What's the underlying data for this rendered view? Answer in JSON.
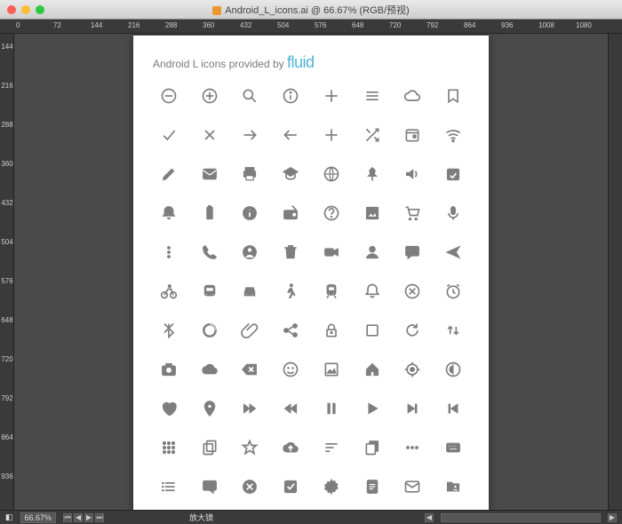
{
  "window": {
    "title": "Android_L_icons.ai @ 66.67% (RGB/预视)"
  },
  "ruler_top": [
    "0",
    "72",
    "144",
    "216",
    "288",
    "360",
    "432",
    "504",
    "576",
    "648",
    "720",
    "792",
    "864",
    "936",
    "1008",
    "1080"
  ],
  "ruler_left": [
    "144",
    "216",
    "288",
    "360",
    "432",
    "504",
    "576",
    "648",
    "720",
    "792",
    "864",
    "936"
  ],
  "artboard": {
    "headline_prefix": "Android L icons provided by ",
    "brand": "fluid"
  },
  "icons": [
    [
      "remove-circle-icon",
      "add-circle-icon",
      "search-icon",
      "info-outline-icon",
      "add-icon",
      "menu-icon",
      "cloud-outline-icon",
      "bookmark-outline-icon"
    ],
    [
      "check-icon",
      "close-icon",
      "arrow-right-icon",
      "arrow-left-icon",
      "add-icon",
      "shuffle-icon",
      "event-icon",
      "wifi-icon"
    ],
    [
      "edit-icon",
      "email-icon",
      "print-icon",
      "school-icon",
      "public-icon",
      "pin-icon",
      "volume-icon",
      "event-available-icon"
    ],
    [
      "notifications-icon",
      "battery-icon",
      "info-icon",
      "radio-icon",
      "help-icon",
      "image-icon",
      "shopping-cart-icon",
      "mic-icon"
    ],
    [
      "more-vert-icon",
      "call-icon",
      "account-circle-icon",
      "delete-icon",
      "videocam-icon",
      "person-icon",
      "chat-icon",
      "send-icon"
    ],
    [
      "bike-icon",
      "bus-icon",
      "car-icon",
      "walk-icon",
      "train-icon",
      "notifications-none-icon",
      "cancel-circle-icon",
      "alarm-icon"
    ],
    [
      "bluetooth-icon",
      "data-usage-icon",
      "attachment-icon",
      "share-icon",
      "lock-outline-icon",
      "crop-square-icon",
      "refresh-icon",
      "swap-vert-icon"
    ],
    [
      "camera-icon",
      "cloud-icon",
      "backspace-icon",
      "mood-icon",
      "image-outline-icon",
      "home-icon",
      "gps-icon",
      "brightness-icon"
    ],
    [
      "favorite-icon",
      "location-icon",
      "fast-forward-icon",
      "fast-rewind-icon",
      "pause-icon",
      "play-icon",
      "skip-next-icon",
      "skip-previous-icon"
    ],
    [
      "apps-icon",
      "copy-icon",
      "star-outline-icon",
      "cloud-upload-icon",
      "sort-icon",
      "content-copy-icon",
      "more-horiz-icon",
      "keyboard-icon"
    ],
    [
      "list-icon",
      "comment-icon",
      "error-icon",
      "check-box-icon",
      "settings-icon",
      "description-icon",
      "mail-outline-icon",
      "folder-shared-icon"
    ]
  ],
  "status": {
    "zoom": "66.67%",
    "tool": "放大镜"
  }
}
